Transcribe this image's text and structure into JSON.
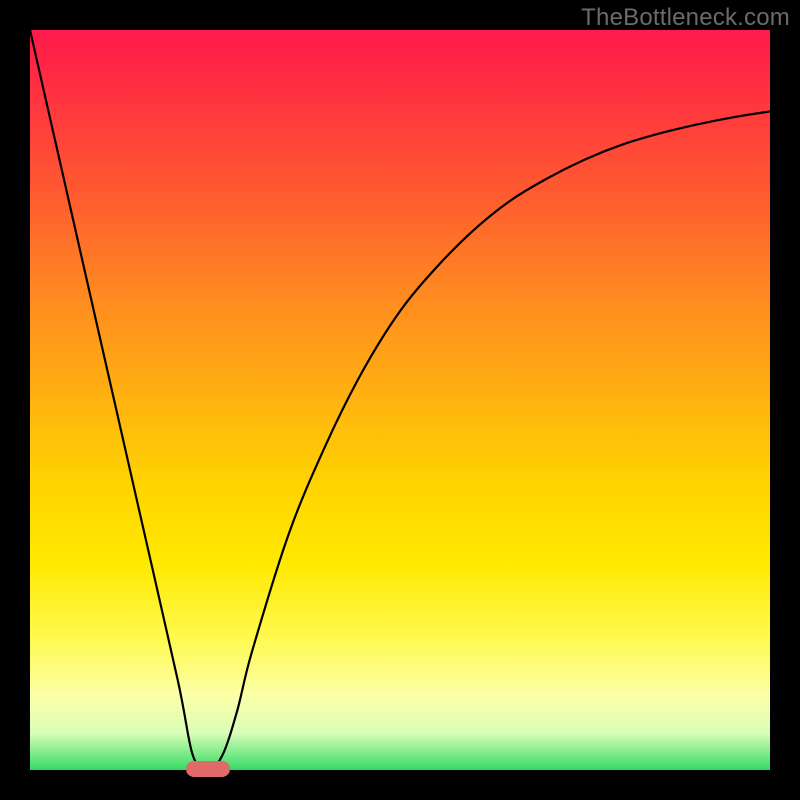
{
  "watermark": "TheBottleneck.com",
  "chart_data": {
    "type": "line",
    "title": "",
    "xlabel": "",
    "ylabel": "",
    "xlim": [
      0,
      100
    ],
    "ylim": [
      0,
      100
    ],
    "grid": false,
    "legend": null,
    "series": [
      {
        "name": "curve",
        "color": "#000000",
        "x": [
          0,
          5,
          10,
          15,
          20,
          22,
          24,
          26,
          28,
          30,
          35,
          40,
          45,
          50,
          55,
          60,
          65,
          70,
          75,
          80,
          85,
          90,
          95,
          100
        ],
        "y": [
          100,
          78,
          56,
          34,
          12,
          2,
          0,
          2,
          8,
          16,
          32,
          44,
          54,
          62,
          68,
          73,
          77,
          80,
          82.5,
          84.5,
          86,
          87.2,
          88.2,
          89
        ]
      }
    ],
    "marker": {
      "x": 24,
      "y": 0,
      "color": "#e06a6a",
      "shape": "pill"
    },
    "background_gradient": {
      "top": "#ff1a4b",
      "mid": "#ffd500",
      "bottom": "#36d964"
    }
  }
}
